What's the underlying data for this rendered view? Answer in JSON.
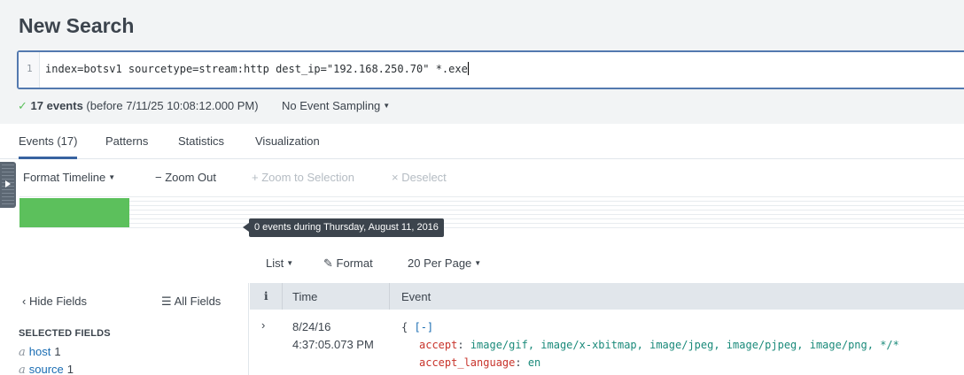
{
  "page": {
    "title": "New Search"
  },
  "search": {
    "line_number": "1",
    "query": "index=botsv1 sourcetype=stream:http dest_ip=\"192.168.250.70\" *.exe"
  },
  "status": {
    "check": "✓",
    "events": "17 events",
    "before": "(before 7/11/25 10:08:12.000 PM)",
    "sampling": "No Event Sampling"
  },
  "tabs": [
    {
      "label": "Events (17)",
      "active": true
    },
    {
      "label": "Patterns"
    },
    {
      "label": "Statistics"
    },
    {
      "label": "Visualization"
    }
  ],
  "timeline_toolbar": {
    "format": "Format Timeline",
    "zoom_out": "Zoom Out",
    "zoom_selection": "Zoom to Selection",
    "deselect": "Deselect"
  },
  "timeline": {
    "tooltip": "0 events during Thursday, August 11, 2016"
  },
  "results_toolbar": {
    "list": "List",
    "format": "Format",
    "per_page": "20 Per Page"
  },
  "fields": {
    "hide": "Hide Fields",
    "all": "All Fields",
    "selected_header": "SELECTED FIELDS",
    "selected": [
      {
        "type": "a",
        "name": "host",
        "count": "1"
      },
      {
        "type": "a",
        "name": "source",
        "count": "1"
      }
    ]
  },
  "table": {
    "col_info": "i",
    "col_time": "Time",
    "col_event": "Event",
    "rows": [
      {
        "expand": "›",
        "date": "8/24/16",
        "time": "4:37:05.073 PM",
        "open": "{",
        "collapse": "[-]",
        "fields": [
          {
            "key": "accept",
            "value": "image/gif, image/x-xbitmap, image/jpeg, image/pjpeg, image/png, */*"
          },
          {
            "key": "accept_language",
            "value": "en"
          }
        ]
      }
    ]
  },
  "colors": {
    "accent": "#3863a0",
    "success": "#5cc05c",
    "field_key": "#c8342b",
    "field_value": "#1a8a7a"
  }
}
